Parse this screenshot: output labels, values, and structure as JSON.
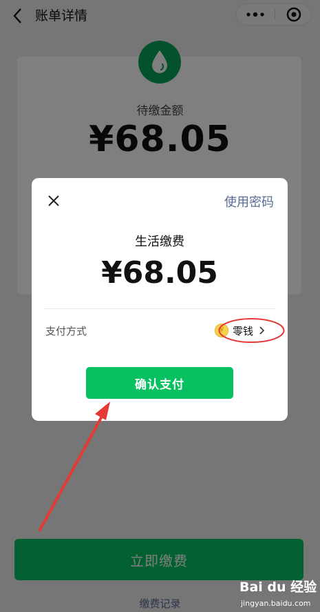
{
  "header": {
    "title": "账单详情"
  },
  "bill": {
    "due_label": "待缴金额",
    "due_amount": "¥68.05"
  },
  "bottom": {
    "pay_now_label": "立即缴费",
    "records_label": "缴费记录"
  },
  "dialog": {
    "use_password_label": "使用密码",
    "title": "生活缴费",
    "amount": "¥68.05",
    "method_label": "支付方式",
    "method_value": "零钱",
    "confirm_label": "确认支付"
  },
  "watermark": {
    "brand": "Bai du 经验",
    "url": "jingyan.baidu.com"
  },
  "colors": {
    "wechat_green": "#07c160",
    "link_blue": "#576b95",
    "annotation_red": "#e53935"
  }
}
